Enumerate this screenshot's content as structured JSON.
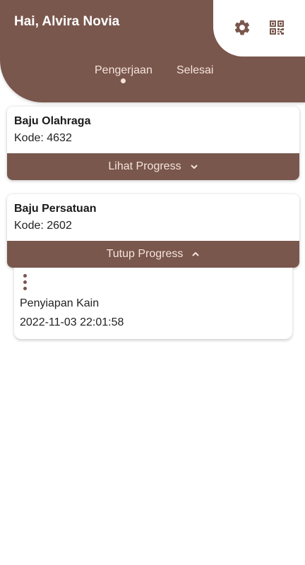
{
  "header": {
    "greeting": "Hai, Alvira Novia",
    "icons": [
      "gear-icon",
      "qr-code-icon"
    ]
  },
  "tabs": [
    {
      "label": "Pengerjaan",
      "active": true
    },
    {
      "label": "Selesai",
      "active": false
    }
  ],
  "orders": [
    {
      "name": "Baju Olahraga",
      "code": "Kode: 4632",
      "toggle_label": "Lihat Progress",
      "expanded": false
    },
    {
      "name": "Baju Persatuan",
      "code": "Kode: 2602",
      "toggle_label": "Tutup Progress",
      "expanded": true
    }
  ],
  "progress": [
    {
      "step": "Penyiapan Kain",
      "timestamp": "2022-11-03 22:01:58"
    }
  ],
  "colors": {
    "primary": "#79574d",
    "tab_text": "#f6e3dc",
    "background": "#ffffff"
  }
}
